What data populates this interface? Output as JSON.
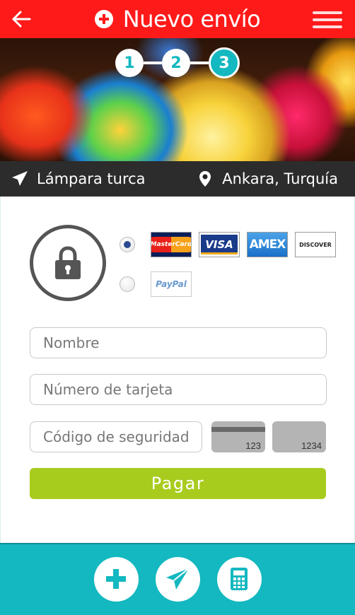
{
  "header": {
    "title": "Nuevo envío",
    "back_icon": "arrow-left-icon",
    "title_icon": "plus-circle-icon",
    "menu_icon": "hamburger-menu-icon",
    "color": "#ff1a1a"
  },
  "stepper": {
    "steps": [
      "1",
      "2",
      "3"
    ],
    "current": 3,
    "accent": "#13b8c0"
  },
  "shipment": {
    "item": "Lámpara turca",
    "item_icon": "paper-plane-icon",
    "location": "Ankara, Turquía",
    "location_icon": "map-pin-icon"
  },
  "payment": {
    "lock_icon": "padlock-icon",
    "methods": [
      {
        "selected": true,
        "cards": [
          "MasterCard",
          "VISA",
          "AMEX",
          "DISCOVER"
        ]
      },
      {
        "selected": false,
        "cards": [
          "PayPal"
        ]
      }
    ],
    "name_placeholder": "Nombre",
    "card_number_placeholder": "Número de tarjeta",
    "security_code_placeholder": "Código de seguridad",
    "cvv_examples": [
      "123",
      "1234"
    ],
    "pay_label": "Pagar",
    "pay_color": "#a8cc1e"
  },
  "bottom_nav": {
    "items": [
      "plus-icon",
      "paper-plane-icon",
      "calculator-icon"
    ],
    "color": "#13b8c0"
  }
}
